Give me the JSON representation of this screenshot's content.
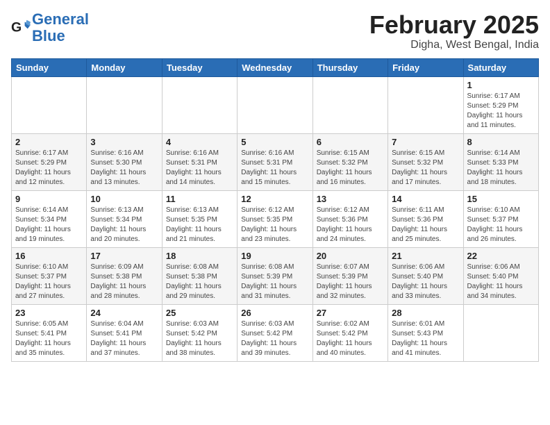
{
  "logo": {
    "text_general": "General",
    "text_blue": "Blue"
  },
  "header": {
    "title": "February 2025",
    "subtitle": "Digha, West Bengal, India"
  },
  "weekdays": [
    "Sunday",
    "Monday",
    "Tuesday",
    "Wednesday",
    "Thursday",
    "Friday",
    "Saturday"
  ],
  "weeks": [
    [
      {
        "day": "",
        "info": ""
      },
      {
        "day": "",
        "info": ""
      },
      {
        "day": "",
        "info": ""
      },
      {
        "day": "",
        "info": ""
      },
      {
        "day": "",
        "info": ""
      },
      {
        "day": "",
        "info": ""
      },
      {
        "day": "1",
        "info": "Sunrise: 6:17 AM\nSunset: 5:29 PM\nDaylight: 11 hours and 11 minutes."
      }
    ],
    [
      {
        "day": "2",
        "info": "Sunrise: 6:17 AM\nSunset: 5:29 PM\nDaylight: 11 hours and 12 minutes."
      },
      {
        "day": "3",
        "info": "Sunrise: 6:16 AM\nSunset: 5:30 PM\nDaylight: 11 hours and 13 minutes."
      },
      {
        "day": "4",
        "info": "Sunrise: 6:16 AM\nSunset: 5:31 PM\nDaylight: 11 hours and 14 minutes."
      },
      {
        "day": "5",
        "info": "Sunrise: 6:16 AM\nSunset: 5:31 PM\nDaylight: 11 hours and 15 minutes."
      },
      {
        "day": "6",
        "info": "Sunrise: 6:15 AM\nSunset: 5:32 PM\nDaylight: 11 hours and 16 minutes."
      },
      {
        "day": "7",
        "info": "Sunrise: 6:15 AM\nSunset: 5:32 PM\nDaylight: 11 hours and 17 minutes."
      },
      {
        "day": "8",
        "info": "Sunrise: 6:14 AM\nSunset: 5:33 PM\nDaylight: 11 hours and 18 minutes."
      }
    ],
    [
      {
        "day": "9",
        "info": "Sunrise: 6:14 AM\nSunset: 5:34 PM\nDaylight: 11 hours and 19 minutes."
      },
      {
        "day": "10",
        "info": "Sunrise: 6:13 AM\nSunset: 5:34 PM\nDaylight: 11 hours and 20 minutes."
      },
      {
        "day": "11",
        "info": "Sunrise: 6:13 AM\nSunset: 5:35 PM\nDaylight: 11 hours and 21 minutes."
      },
      {
        "day": "12",
        "info": "Sunrise: 6:12 AM\nSunset: 5:35 PM\nDaylight: 11 hours and 23 minutes."
      },
      {
        "day": "13",
        "info": "Sunrise: 6:12 AM\nSunset: 5:36 PM\nDaylight: 11 hours and 24 minutes."
      },
      {
        "day": "14",
        "info": "Sunrise: 6:11 AM\nSunset: 5:36 PM\nDaylight: 11 hours and 25 minutes."
      },
      {
        "day": "15",
        "info": "Sunrise: 6:10 AM\nSunset: 5:37 PM\nDaylight: 11 hours and 26 minutes."
      }
    ],
    [
      {
        "day": "16",
        "info": "Sunrise: 6:10 AM\nSunset: 5:37 PM\nDaylight: 11 hours and 27 minutes."
      },
      {
        "day": "17",
        "info": "Sunrise: 6:09 AM\nSunset: 5:38 PM\nDaylight: 11 hours and 28 minutes."
      },
      {
        "day": "18",
        "info": "Sunrise: 6:08 AM\nSunset: 5:38 PM\nDaylight: 11 hours and 29 minutes."
      },
      {
        "day": "19",
        "info": "Sunrise: 6:08 AM\nSunset: 5:39 PM\nDaylight: 11 hours and 31 minutes."
      },
      {
        "day": "20",
        "info": "Sunrise: 6:07 AM\nSunset: 5:39 PM\nDaylight: 11 hours and 32 minutes."
      },
      {
        "day": "21",
        "info": "Sunrise: 6:06 AM\nSunset: 5:40 PM\nDaylight: 11 hours and 33 minutes."
      },
      {
        "day": "22",
        "info": "Sunrise: 6:06 AM\nSunset: 5:40 PM\nDaylight: 11 hours and 34 minutes."
      }
    ],
    [
      {
        "day": "23",
        "info": "Sunrise: 6:05 AM\nSunset: 5:41 PM\nDaylight: 11 hours and 35 minutes."
      },
      {
        "day": "24",
        "info": "Sunrise: 6:04 AM\nSunset: 5:41 PM\nDaylight: 11 hours and 37 minutes."
      },
      {
        "day": "25",
        "info": "Sunrise: 6:03 AM\nSunset: 5:42 PM\nDaylight: 11 hours and 38 minutes."
      },
      {
        "day": "26",
        "info": "Sunrise: 6:03 AM\nSunset: 5:42 PM\nDaylight: 11 hours and 39 minutes."
      },
      {
        "day": "27",
        "info": "Sunrise: 6:02 AM\nSunset: 5:42 PM\nDaylight: 11 hours and 40 minutes."
      },
      {
        "day": "28",
        "info": "Sunrise: 6:01 AM\nSunset: 5:43 PM\nDaylight: 11 hours and 41 minutes."
      },
      {
        "day": "",
        "info": ""
      }
    ]
  ],
  "row_shading": [
    false,
    true,
    false,
    true,
    false
  ]
}
